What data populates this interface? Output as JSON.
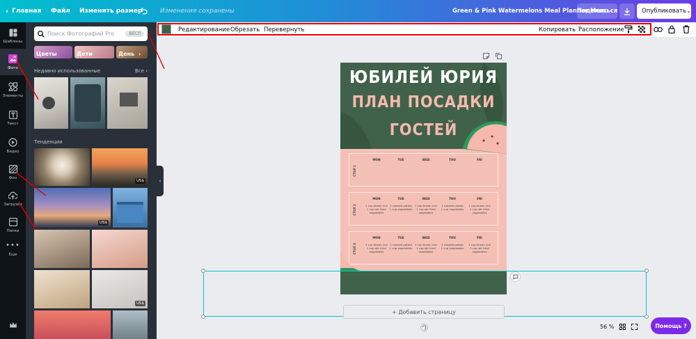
{
  "topbar": {
    "home": "Главная",
    "file": "Файл",
    "resize": "Изменить размер",
    "saved_status": "Изменения сохранены",
    "design_title": "Green & Pink Watermelons Meal Planner Menu",
    "share": "Поделиться",
    "publish": "Опубликовать"
  },
  "rail": {
    "items": [
      {
        "label": "Шаблоны"
      },
      {
        "label": "Фото"
      },
      {
        "label": "Элементы"
      },
      {
        "label": "Текст"
      },
      {
        "label": "Видео"
      },
      {
        "label": "Фон"
      },
      {
        "label": "Загрузки"
      },
      {
        "label": "Папки"
      },
      {
        "label": "Еще"
      }
    ]
  },
  "panel": {
    "search_placeholder": "Поиск Фотографий Pro",
    "search_badge": "ВЕСЛ",
    "categories": [
      "Цветы",
      "Дети",
      "День"
    ],
    "recent_title": "Недавно использованные",
    "see_all": "Все",
    "trending_title": "Тенденции",
    "price_tag": "US$"
  },
  "toolbar": {
    "edit": "Редактирование",
    "crop": "Обрезать",
    "flip": "Перевернуть",
    "copy": "Копировать",
    "arrange": "Расположение",
    "swatch_color": "#40624a"
  },
  "page": {
    "title_line1": "ЮБИЛЕЙ ЮРИЯ",
    "title_line2": "ПЛАН ПОСАДКИ",
    "title_line3": "ГОСТЕЙ",
    "days": [
      "MON",
      "TUE",
      "WED",
      "THU",
      "FRI"
    ],
    "tables": [
      {
        "label": "СТОЛ 1",
        "cells": [
          "",
          "",
          "",
          "",
          ""
        ]
      },
      {
        "label": "СТОЛ 2",
        "cells": [
          "1 cup brown rice\n1 cup stir fried vegetables",
          "1 roasted potato\n1 cup vegetables",
          "1 cup brown rice\n1 cup stir fried vegetables",
          "1 roasted potato\n1 cup vegetables",
          "1 cup brown rice\n1 cup stir fried vegetables"
        ]
      },
      {
        "label": "СТОЛ 3",
        "cells": [
          "1 cup brown rice\n1 cup stir fried vegetables",
          "1 roasted potato\n1 cup vegetables",
          "1 cup brown rice\n1 cup stir fried vegetables",
          "1 roasted potato\n1 cup vegetables",
          "1 cup brown rice\n1 cup stir fried vegetables"
        ]
      }
    ],
    "dark_green": "#40624a",
    "pink": "#f4c0b6"
  },
  "canvas": {
    "add_page": "+ Добавить страницу",
    "zoom": "56 %",
    "help": "Помощь ?"
  },
  "colors": {
    "accent_purple": "#7d2ae8",
    "selection": "#00c4cc",
    "annotation_red": "#e60000"
  }
}
